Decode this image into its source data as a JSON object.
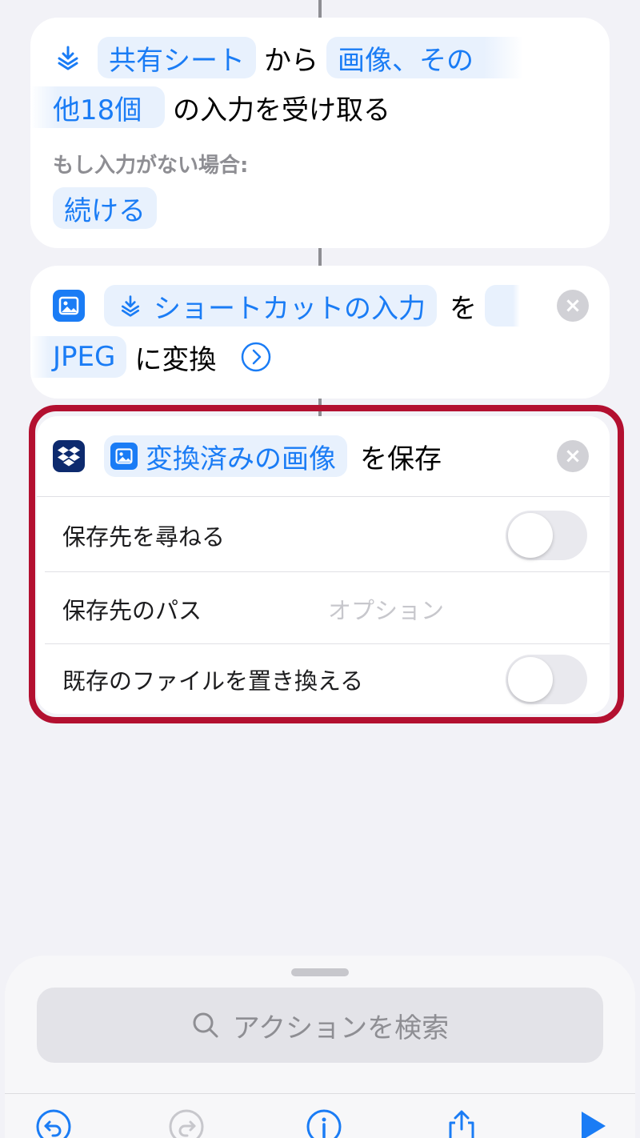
{
  "card1": {
    "source_pill": "共有シート",
    "from_text": "から",
    "types_pill_line1": "画像、その",
    "types_pill_line2": "他18個",
    "receive_text": "の入力を受け取る",
    "no_input_label": "もし入力がない場合:",
    "continue_pill": "続ける"
  },
  "card2": {
    "input_pill": "ショートカットの入力",
    "wo_text": "を",
    "format_pill": "JPEG",
    "convert_text": "に変換"
  },
  "card3": {
    "image_pill": "変換済みの画像",
    "save_text": "を保存",
    "ask_where_label": "保存先を尋ねる",
    "ask_where_on": false,
    "dest_path_label": "保存先のパス",
    "dest_path_placeholder": "オプション",
    "overwrite_label": "既存のファイルを置き換える",
    "overwrite_on": false
  },
  "bottom": {
    "search_placeholder": "アクションを検索"
  },
  "colors": {
    "accent": "#1a7cf5",
    "pill_bg": "#e8f1fd",
    "highlight": "#b31030",
    "dropbox": "#0d2a6e"
  }
}
